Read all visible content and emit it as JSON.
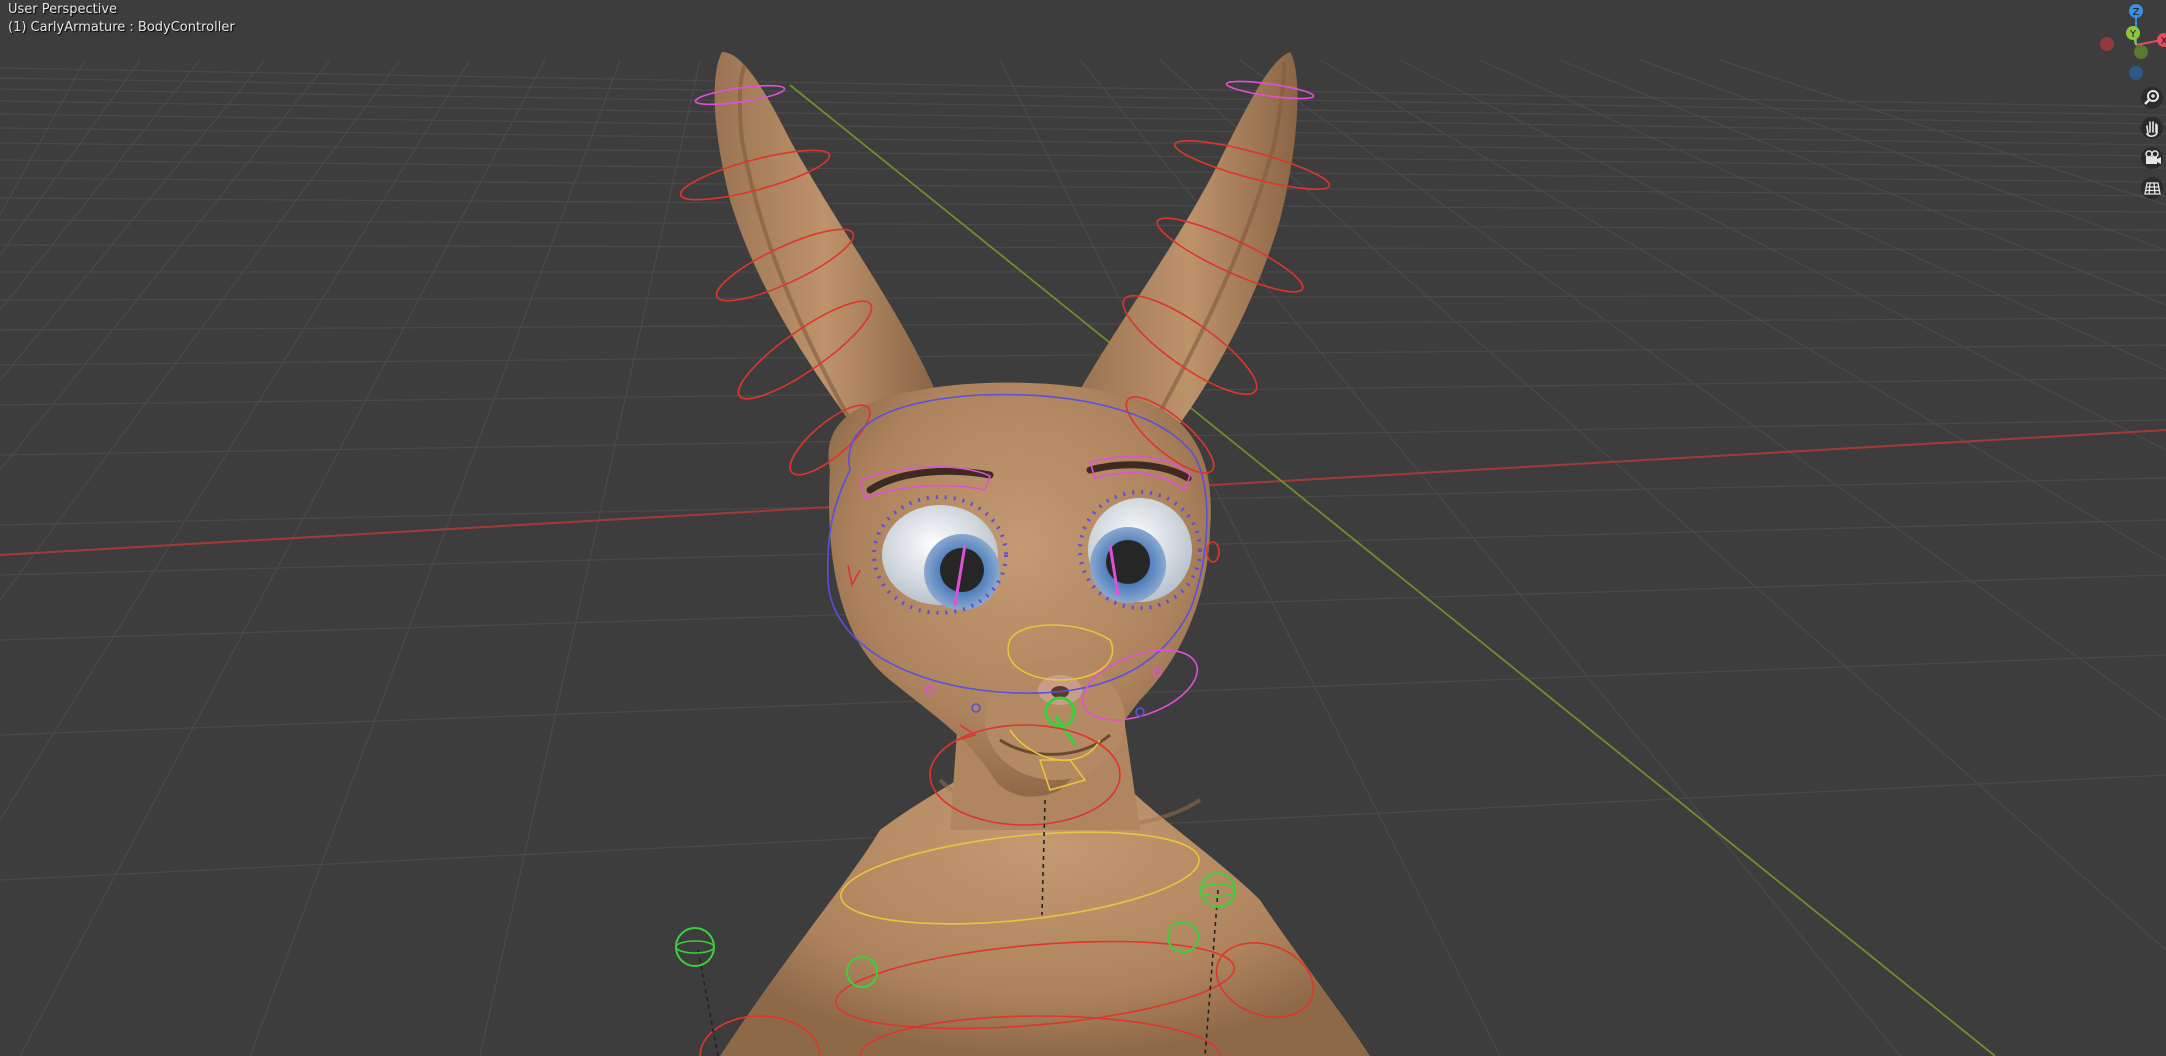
{
  "viewport": {
    "view_name": "User Perspective",
    "object_info": "(1) CarlyArmature : BodyController"
  },
  "gizmo": {
    "axis_z": "Z",
    "axis_y": "Y",
    "axis_x": "X",
    "colors": {
      "x": "#e84a5f",
      "y": "#8cc63f",
      "z": "#3a8fde",
      "neg_x": "#a8383f",
      "neg_y": "#5f8a2a",
      "neg_z": "#2a5f98"
    }
  },
  "nav_buttons": [
    {
      "icon": "zoom-icon",
      "label": "Zoom"
    },
    {
      "icon": "hand-icon",
      "label": "Move"
    },
    {
      "icon": "camera-icon",
      "label": "Camera"
    },
    {
      "icon": "grid-icon",
      "label": "Perspective"
    }
  ],
  "colors": {
    "background": "#3d3d3d",
    "grid": "#4b4b4b",
    "x_axis": "#a53a3a",
    "y_axis": "#7a9b2e",
    "skin": "#b58b64",
    "skin_dark": "#8d6a4a",
    "rig_red": "#e0352b",
    "rig_magenta": "#e24fd8",
    "rig_yellow": "#e8c53a",
    "rig_green": "#39d13b",
    "rig_blue": "#5b4fe0"
  }
}
